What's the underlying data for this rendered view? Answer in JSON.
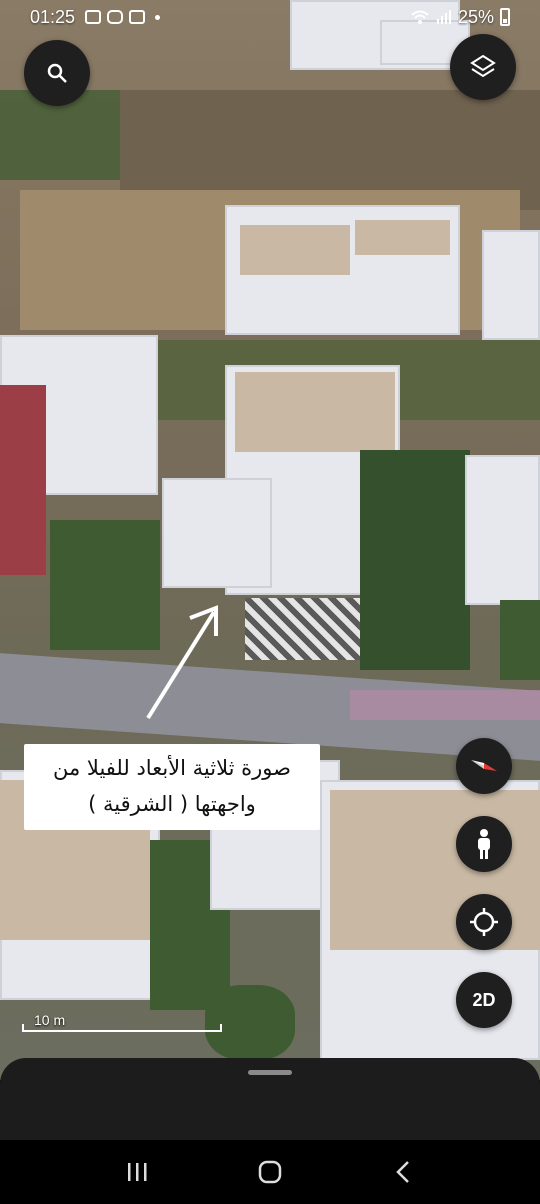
{
  "status_bar": {
    "time": "01:25",
    "battery": "25%"
  },
  "map": {
    "caption": "صورة ثلاثية الأبعاد للفيلا من واجهتها ( الشرقية )",
    "scale_label": "10 m",
    "view_mode_label": "2D"
  },
  "icons": {
    "search": "search-icon",
    "layers": "layers-icon",
    "compass": "compass-icon",
    "street_view": "street-view-icon",
    "my_location": "my-location-icon",
    "recents": "recents-icon",
    "home": "home-icon",
    "back": "back-icon"
  },
  "colors": {
    "button_bg": "#1f1f1f",
    "compass_red": "#e53935",
    "sheet_bg": "#1c1c1c"
  }
}
